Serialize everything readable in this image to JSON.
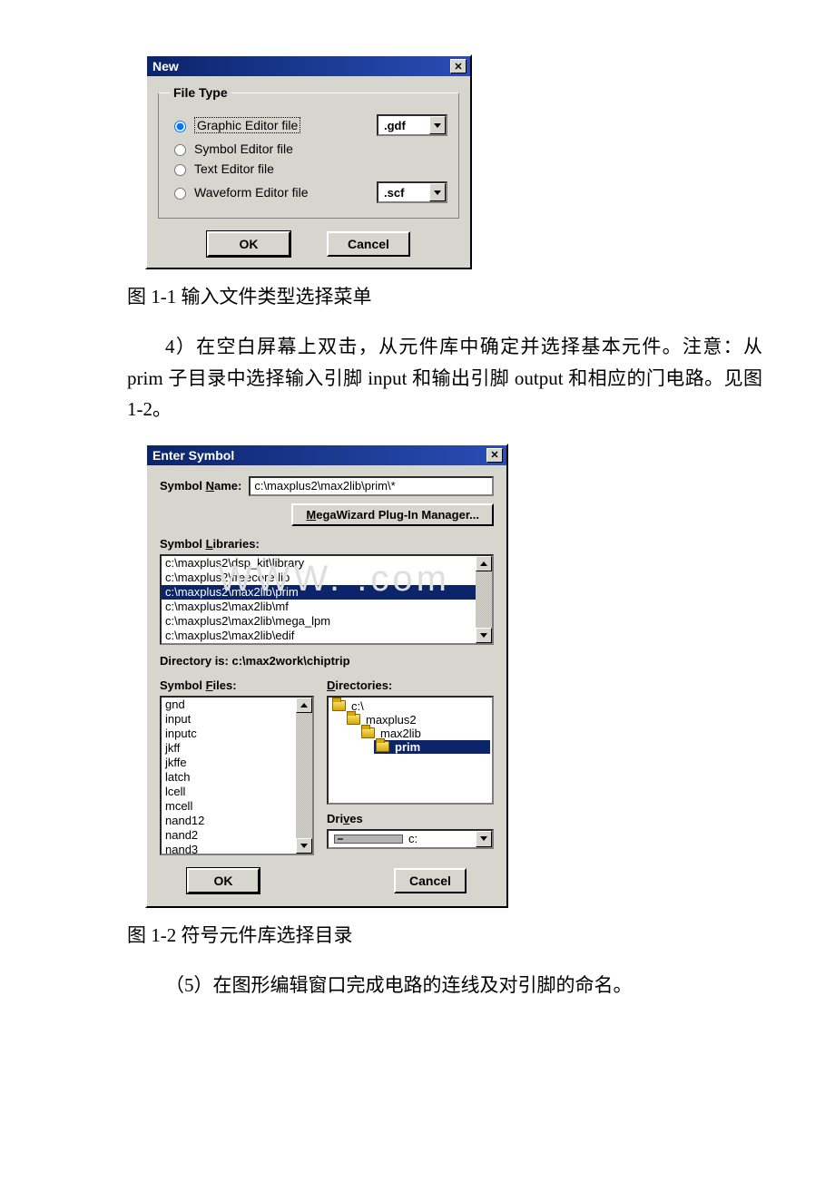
{
  "dialog1": {
    "title": "New",
    "group_title": "File Type",
    "radios": [
      {
        "label": "Graphic Editor file",
        "ext": ".gdf",
        "selected": true,
        "has_ext": true
      },
      {
        "label": "Symbol Editor file",
        "selected": false,
        "has_ext": false
      },
      {
        "label": "Text Editor file",
        "selected": false,
        "has_ext": false
      },
      {
        "label": "Waveform Editor file",
        "ext": ".scf",
        "selected": false,
        "has_ext": true
      }
    ],
    "ok": "OK",
    "cancel": "Cancel"
  },
  "caption1": "图 1-1 输入文件类型选择菜单",
  "para1": "4）在空白屏幕上双击，从元件库中确定并选择基本元件。注意：从 prim 子目录中选择输入引脚 input 和输出引脚 output 和相应的门电路。见图 1-2。",
  "watermark": "WWW.           .com",
  "dialog2": {
    "title": "Enter Symbol",
    "symbol_name_label": "Symbol Name:",
    "symbol_name_value": "c:\\maxplus2\\max2lib\\prim\\*",
    "mega_btn": "MegaWizard Plug-In Manager...",
    "libs_label": "Symbol Libraries:",
    "libs": [
      "c:\\maxplus2\\dsp_kit\\library",
      "c:\\maxplus2\\freecore lib",
      "c:\\maxplus2\\max2lib\\prim",
      "c:\\maxplus2\\max2lib\\mf",
      "c:\\maxplus2\\max2lib\\mega_lpm",
      "c:\\maxplus2\\max2lib\\edif"
    ],
    "libs_selected_index": 2,
    "dir_is_label": "Directory is:  c:\\max2work\\chiptrip",
    "files_label": "Symbol Files:",
    "files": [
      "gnd",
      "input",
      "inputc",
      "jkff",
      "jkffe",
      "latch",
      "lcell",
      "mcell",
      "nand12",
      "nand2",
      "nand3"
    ],
    "dirs_label": "Directories:",
    "dirs": [
      {
        "label": "c:\\",
        "level": 1,
        "sel": false
      },
      {
        "label": "maxplus2",
        "level": 2,
        "sel": false
      },
      {
        "label": "max2lib",
        "level": 3,
        "sel": false
      },
      {
        "label": "prim",
        "level": 4,
        "sel": true
      }
    ],
    "drives_label": "Drives",
    "drive_selected": "c:",
    "ok": "OK",
    "cancel": "Cancel"
  },
  "caption2": "图 1-2 符号元件库选择目录",
  "para2": "（5）在图形编辑窗口完成电路的连线及对引脚的命名。"
}
